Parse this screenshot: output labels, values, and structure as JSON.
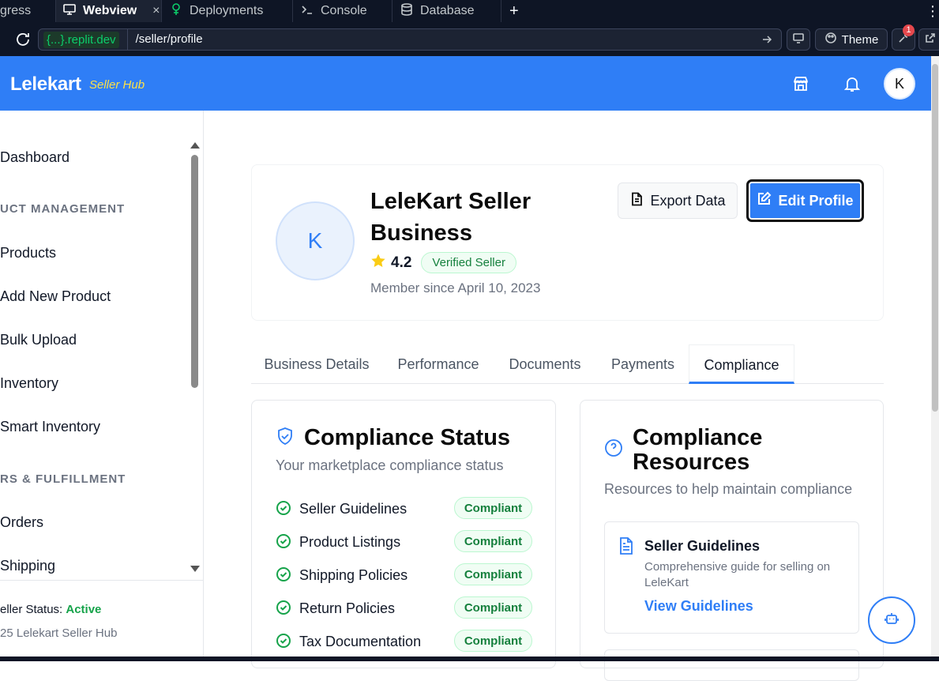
{
  "replit": {
    "tabs": [
      {
        "label": "gress"
      },
      {
        "label": "Webview"
      },
      {
        "label": "Deployments"
      },
      {
        "label": "Console"
      },
      {
        "label": "Database"
      }
    ],
    "url_host": "{...}.replit.dev",
    "url_path": "/seller/profile",
    "theme_label": "Theme",
    "notif_count": "1"
  },
  "header": {
    "brand": "Lelekart",
    "brand_sub": "Seller Hub",
    "avatar_initial": "K"
  },
  "sidebar": {
    "items": [
      {
        "label": "Dashboard"
      },
      {
        "label": "UCT MANAGEMENT"
      },
      {
        "label": "Products"
      },
      {
        "label": "Add New Product"
      },
      {
        "label": "Bulk Upload"
      },
      {
        "label": "Inventory"
      },
      {
        "label": "Smart Inventory"
      },
      {
        "label": "RS & FULFILLMENT"
      },
      {
        "label": "Orders"
      },
      {
        "label": "Shipping"
      }
    ],
    "status_label": "eller Status: ",
    "status_value": "Active",
    "copyright": "25 Lelekart Seller Hub"
  },
  "profile": {
    "avatar_initial": "K",
    "name_line1": "LeleKart Seller",
    "name_line2": "Business",
    "rating": "4.2",
    "verified": "Verified Seller",
    "member_since": "Member since April 10, 2023",
    "export_label": "Export Data",
    "edit_label": "Edit Profile"
  },
  "tabs": [
    {
      "label": "Business Details"
    },
    {
      "label": "Performance"
    },
    {
      "label": "Documents"
    },
    {
      "label": "Payments"
    },
    {
      "label": "Compliance"
    }
  ],
  "compliance_status": {
    "title": "Compliance Status",
    "desc": "Your marketplace compliance status",
    "rows": [
      {
        "label": "Seller Guidelines",
        "status": "Compliant"
      },
      {
        "label": "Product Listings",
        "status": "Compliant"
      },
      {
        "label": "Shipping Policies",
        "status": "Compliant"
      },
      {
        "label": "Return Policies",
        "status": "Compliant"
      },
      {
        "label": "Tax Documentation",
        "status": "Compliant"
      }
    ]
  },
  "compliance_resources": {
    "title_line1": "Compliance",
    "title_line2": "Resources",
    "desc": "Resources to help maintain compliance",
    "card": {
      "title": "Seller Guidelines",
      "desc": "Comprehensive guide for selling on LeleKart",
      "link": "View Guidelines"
    }
  },
  "colors": {
    "brand_blue": "#2f7ef6",
    "compliant_green": "#15803d",
    "brand_sub_yellow": "#fde047"
  }
}
